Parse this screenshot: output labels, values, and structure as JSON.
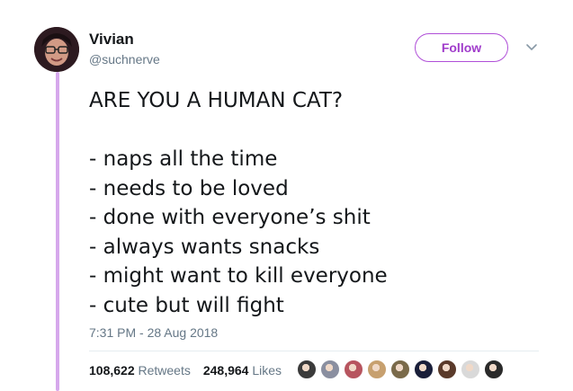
{
  "user": {
    "name": "Vivian",
    "handle": "@suchnerve"
  },
  "follow_label": "Follow",
  "tweet": {
    "title": "ARE YOU A HUMAN CAT?",
    "lines": [
      "- naps all the time",
      "- needs to be loved",
      "- done with everyone’s shit",
      "- always wants snacks",
      "- might want to kill everyone",
      "- cute but will fight"
    ],
    "timestamp": "7:31 PM - 28 Aug 2018"
  },
  "stats": {
    "retweets_count": "108,622",
    "retweets_label": "Retweets",
    "likes_count": "248,964",
    "likes_label": "Likes"
  },
  "likers": [
    {
      "color": "#3b3b3b"
    },
    {
      "color": "#8a8fa0"
    },
    {
      "color": "#b7555f"
    },
    {
      "color": "#c7a06f"
    },
    {
      "color": "#7a6a4a"
    },
    {
      "color": "#1a1f3a"
    },
    {
      "color": "#5a3a2a"
    },
    {
      "color": "#d9d9d9"
    },
    {
      "color": "#2a2a2a"
    }
  ],
  "colors": {
    "accent": "#a03ccb",
    "thread_line": "#d6a8ec"
  }
}
